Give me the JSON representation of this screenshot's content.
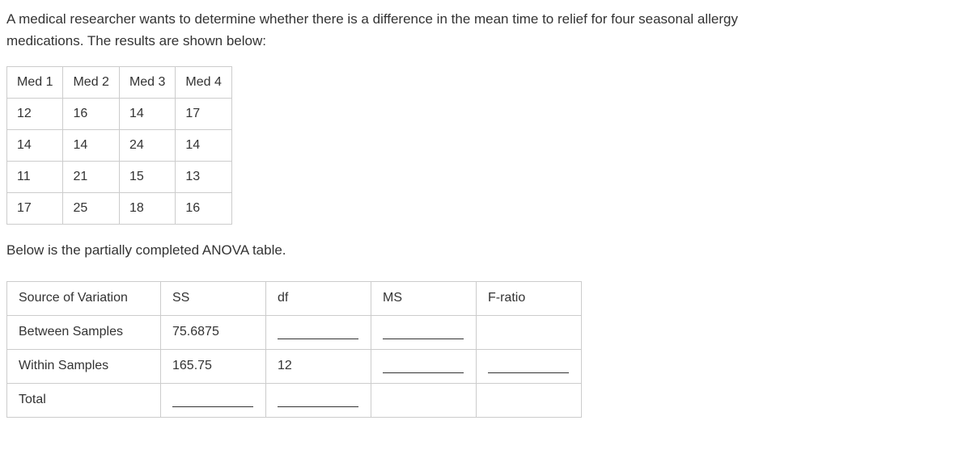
{
  "intro_line1": "A medical researcher wants to determine whether there is a difference in the mean time to relief for four seasonal allergy",
  "intro_line2": "medications. The results are shown below:",
  "data_table": {
    "headers": [
      "Med 1",
      "Med 2",
      "Med 3",
      "Med 4"
    ],
    "rows": [
      [
        "12",
        "16",
        "14",
        "17"
      ],
      [
        "14",
        "14",
        "24",
        "14"
      ],
      [
        "11",
        "21",
        "15",
        "13"
      ],
      [
        "17",
        "25",
        "18",
        "16"
      ]
    ]
  },
  "mid_text": "Below is the partially completed ANOVA table.",
  "anova": {
    "headers": [
      "Source of Variation",
      "SS",
      "df",
      "MS",
      "F-ratio"
    ],
    "rows": [
      {
        "label": "Between Samples",
        "ss": "75.6875",
        "df": "",
        "ms": "",
        "f": ""
      },
      {
        "label": "Within Samples",
        "ss": "165.75",
        "df": "12",
        "ms": "",
        "f": ""
      },
      {
        "label": "Total",
        "ss": "",
        "df": "",
        "ms": null,
        "f": null
      }
    ]
  }
}
